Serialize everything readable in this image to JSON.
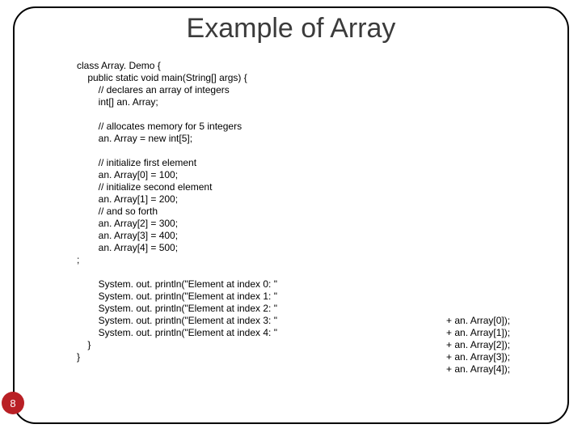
{
  "title": "Example of Array",
  "page_number": "8",
  "code_left": "class Array. Demo {\n    public static void main(String[] args) {\n        // declares an array of integers\n        int[] an. Array;\n\n        // allocates memory for 5 integers\n        an. Array = new int[5];\n\n        // initialize first element\n        an. Array[0] = 100;\n        // initialize second element\n        an. Array[1] = 200;\n        // and so forth\n        an. Array[2] = 300;\n        an. Array[3] = 400;\n        an. Array[4] = 500;\n;\n\n        System. out. println(\"Element at index 0: \"\n        System. out. println(\"Element at index 1: \"\n        System. out. println(\"Element at index 2: \"\n        System. out. println(\"Element at index 3: \"\n        System. out. println(\"Element at index 4: \"\n    }\n}",
  "code_right": "+ an. Array[0]);\n+ an. Array[1]);\n+ an. Array[2]);\n+ an. Array[3]);\n+ an. Array[4]);"
}
